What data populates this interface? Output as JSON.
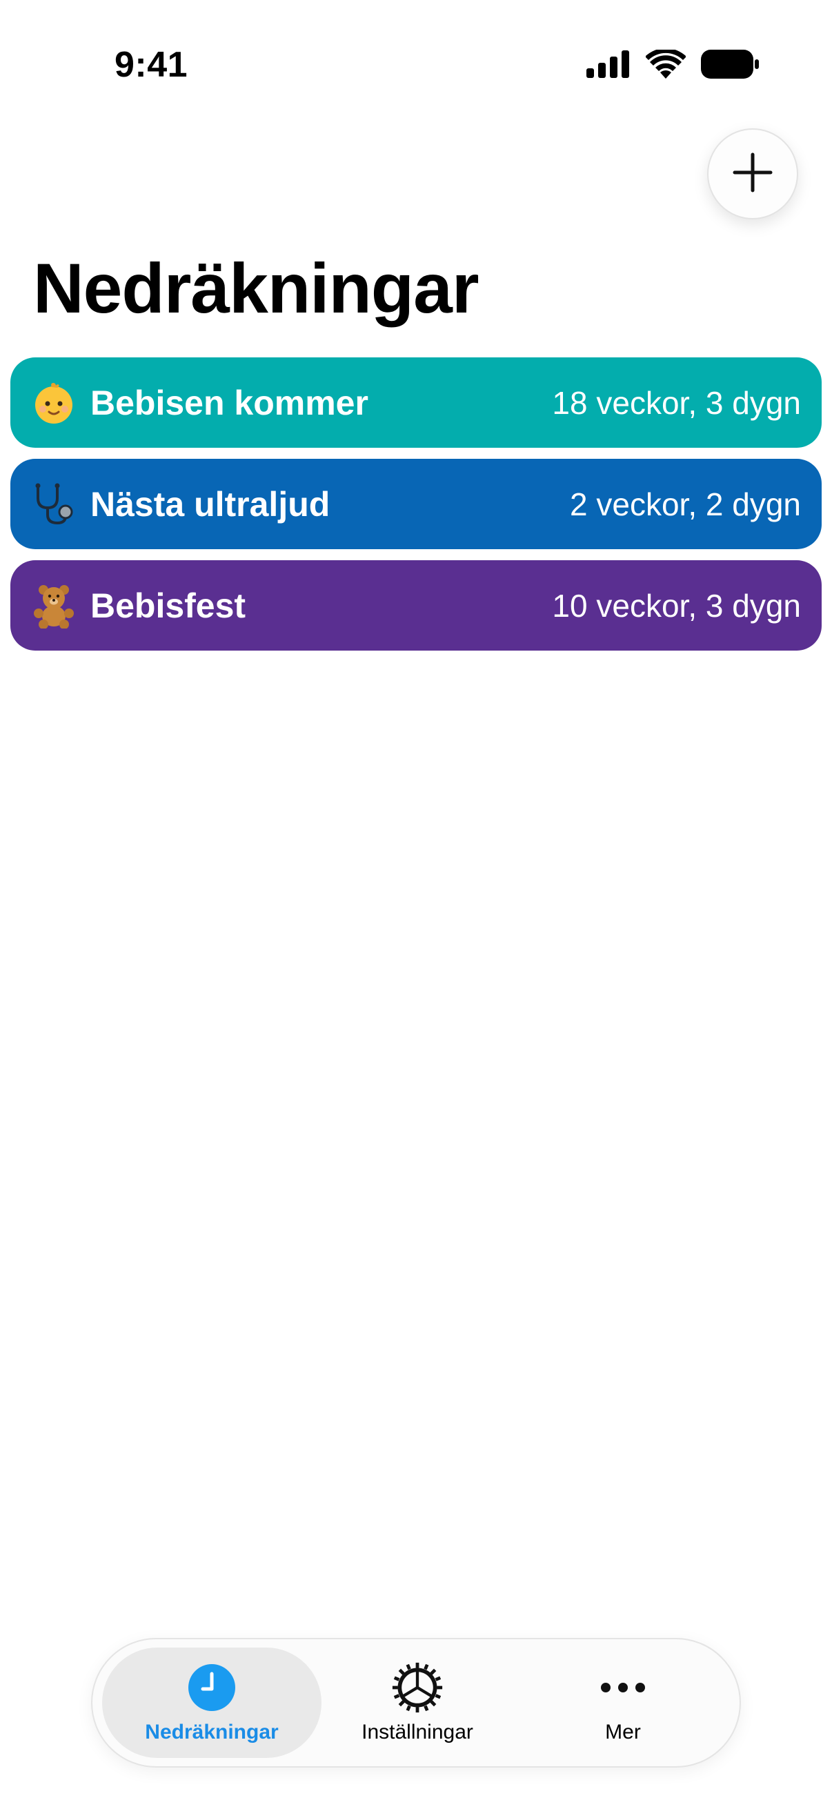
{
  "status_bar": {
    "time": "9:41"
  },
  "header": {
    "title": "Nedräkningar"
  },
  "countdowns": [
    {
      "icon": "baby-emoji",
      "emoji": "👶",
      "title": "Bebisen kommer",
      "remaining": "18 veckor, 3 dygn",
      "color": "#03ADAD"
    },
    {
      "icon": "stethoscope-emoji",
      "emoji": "🩺",
      "title": "Nästa ultraljud",
      "remaining": "2 veckor, 2 dygn",
      "color": "#0866B5"
    },
    {
      "icon": "teddy-bear-emoji",
      "emoji": "🧸",
      "title": "Bebisfest",
      "remaining": "10 veckor, 3 dygn",
      "color": "#5A2F91"
    }
  ],
  "tab_bar": {
    "active": "Nedräkningar",
    "tabs": [
      {
        "label": "Nedräkningar",
        "icon": "clock-icon"
      },
      {
        "label": "Inställningar",
        "icon": "gear-icon"
      },
      {
        "label": "Mer",
        "icon": "ellipsis-icon"
      }
    ]
  },
  "colors": {
    "accent": "#1A8CE6",
    "background": "#FFFFFF"
  }
}
